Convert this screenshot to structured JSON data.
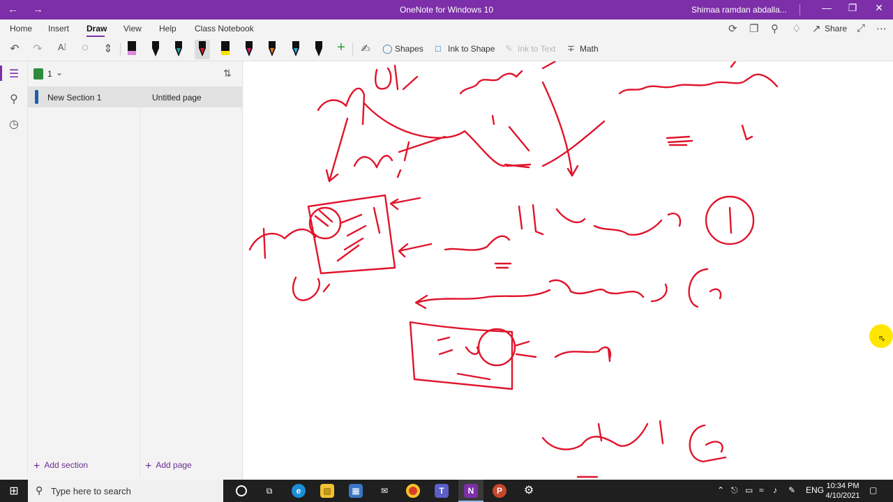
{
  "titlebar": {
    "back_icon": "back-arrow-icon",
    "forward_icon": "forward-arrow-icon",
    "title": "OneNote for Windows 10",
    "user": "Shimaa ramdan abdalla...",
    "minimize": "—",
    "maximize": "❐",
    "close": "✕",
    "accent": "#7c2fa8"
  },
  "ribbon": {
    "tabs": [
      "Home",
      "Insert",
      "Draw",
      "View",
      "Help",
      "Class Notebook"
    ],
    "active_tab": "Draw",
    "share_label": "Share"
  },
  "toolbar": {
    "shapes_label": "Shapes",
    "ink_to_shape_label": "Ink to Shape",
    "ink_to_text_label": "Ink to Text",
    "math_label": "Math",
    "pens": [
      {
        "name": "highlighter-pink",
        "color": "#d98ad8"
      },
      {
        "name": "pen-black",
        "color": "#111111"
      },
      {
        "name": "pen-teal",
        "color": "#2a9da6"
      },
      {
        "name": "pen-red",
        "color": "#e0142b"
      },
      {
        "name": "highlighter-yellow",
        "color": "#f5e400"
      },
      {
        "name": "pen-magenta",
        "color": "#d6196b"
      },
      {
        "name": "pen-orange",
        "color": "#e37c12"
      },
      {
        "name": "pen-cyan",
        "color": "#29a7d8"
      },
      {
        "name": "pen-black-2",
        "color": "#111111"
      }
    ]
  },
  "notebook": {
    "name": "1",
    "sections": [
      {
        "label": "New Section 1",
        "color": "#1f5fa8"
      }
    ],
    "pages": [
      {
        "label": "Untitled page"
      }
    ],
    "add_section": "Add section",
    "add_page": "Add page"
  },
  "canvas": {
    "ink_color": "#e0142b"
  },
  "taskbar": {
    "search_placeholder": "Type here to search",
    "language": "ENG",
    "time": "10:34 PM",
    "date": "4/10/2021"
  }
}
